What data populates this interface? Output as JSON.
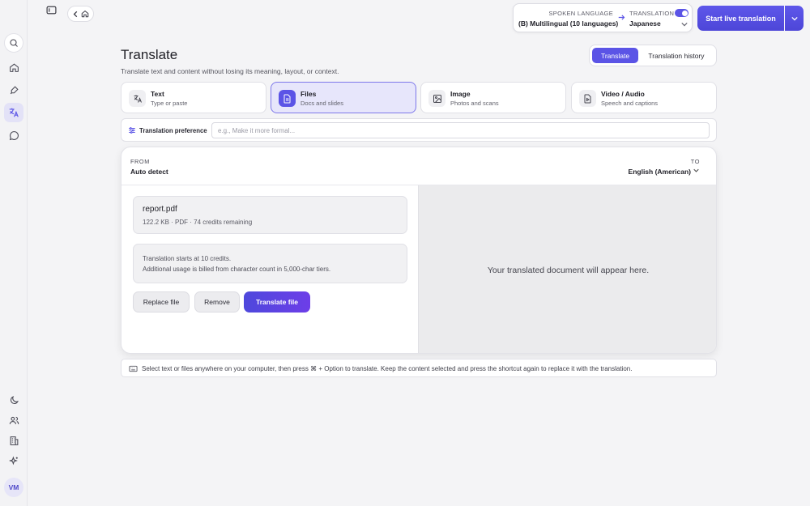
{
  "header": {
    "nav_back": "back",
    "spoken_language": {
      "caption": "SPOKEN LANGUAGE",
      "value": "(B) Multilingual (10 languages)"
    },
    "translation": {
      "caption": "TRANSLATION",
      "value": "Japanese",
      "enabled": true
    },
    "start_button": "Start live translation"
  },
  "page": {
    "title": "Translate",
    "subtitle": "Translate text and content without losing its meaning, layout, or context.",
    "tabs": [
      "Translate",
      "Translation history"
    ],
    "active_tab": "Translate"
  },
  "modes": [
    {
      "title": "Text",
      "desc": "Type or paste",
      "icon": "translate-icon"
    },
    {
      "title": "Files",
      "desc": "Docs and slides",
      "icon": "document-icon",
      "active": true
    },
    {
      "title": "Image",
      "desc": "Photos and scans",
      "icon": "image-icon"
    },
    {
      "title": "Video / Audio",
      "desc": "Speech and captions",
      "icon": "video-file-icon"
    }
  ],
  "preference": {
    "label": "Translation preference",
    "placeholder": "e.g., Make it more formal...",
    "value": ""
  },
  "panel": {
    "from_caption": "FROM",
    "from_value": "Auto detect",
    "to_caption": "TO",
    "to_value": "English (American)",
    "file": {
      "name": "report.pdf",
      "meta": "122.2 KB · PDF · 74 credits remaining"
    },
    "info": [
      "Translation starts at 10 credits.",
      "Additional usage is billed from character count in 5,000-char tiers."
    ],
    "buttons": {
      "replace": "Replace file",
      "remove": "Remove",
      "translate": "Translate file"
    },
    "placeholder": "Your translated document will appear here."
  },
  "hint": "Select text or files anywhere on your computer, then press ⌘ + Option to translate. Keep the content selected and press the shortcut again to replace it with the translation.",
  "user": {
    "initials": "VM"
  },
  "colors": {
    "accent": "#5b54e6",
    "active_card": "#e7e6fb",
    "background": "#f4f4f6"
  }
}
